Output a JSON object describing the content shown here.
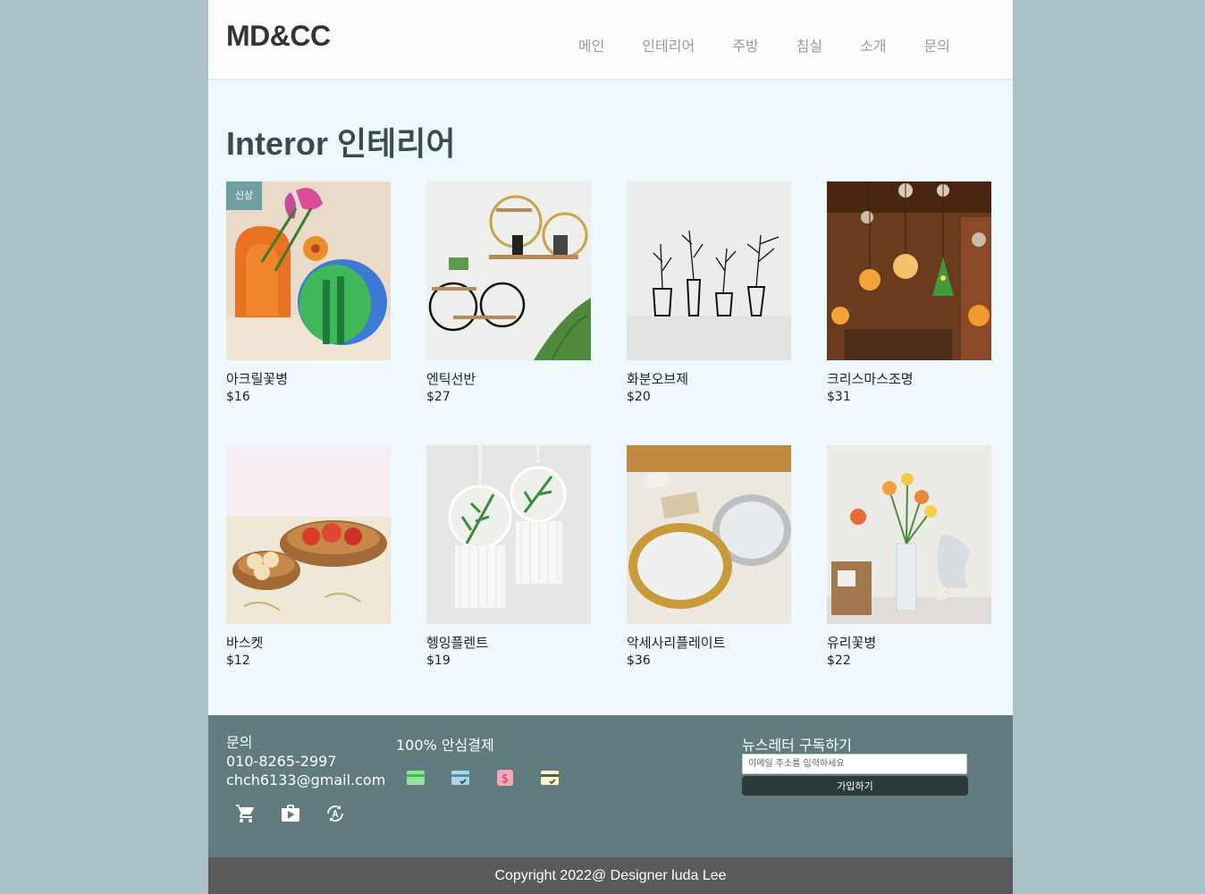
{
  "header": {
    "logo": "MD&CC",
    "nav": [
      "메인",
      "인테리어",
      "주방",
      "침실",
      "소개",
      "문의"
    ]
  },
  "main": {
    "title": "Interor 인테리어",
    "products": [
      {
        "name": "아크릴꽃병",
        "price": "$16",
        "badge": "신상"
      },
      {
        "name": "엔틱선반",
        "price": "$27"
      },
      {
        "name": "화분오브제",
        "price": "$20"
      },
      {
        "name": "크리스마스조명",
        "price": "$31"
      },
      {
        "name": "바스켓",
        "price": "$12"
      },
      {
        "name": "헹잉플렌트",
        "price": "$19"
      },
      {
        "name": "악세사리플레이트",
        "price": "$36"
      },
      {
        "name": "유리꽃병",
        "price": "$22"
      }
    ]
  },
  "footer": {
    "contact_title": "문의",
    "phone": "010-8265-2997",
    "email": "chch6133@gmail.com",
    "icons": [
      "cart-icon",
      "shop-icon",
      "translate-icon"
    ],
    "payment_title": "100% 안심결제",
    "payment_icons": [
      "credit-card-icon",
      "card-check-icon",
      "dollar-icon",
      "card-approved-icon"
    ],
    "payment_colors": [
      "#8fe39a",
      "#a8d8ea",
      "#f7a8b8",
      "#fdf6c6"
    ],
    "newsletter_title": "뉴스레터 구독하기",
    "newsletter_placeholder": "이메일 주소를 입력하세요",
    "subscribe_label": "가입하기"
  },
  "copyright": "Copyright 2022@ Designer luda Lee"
}
